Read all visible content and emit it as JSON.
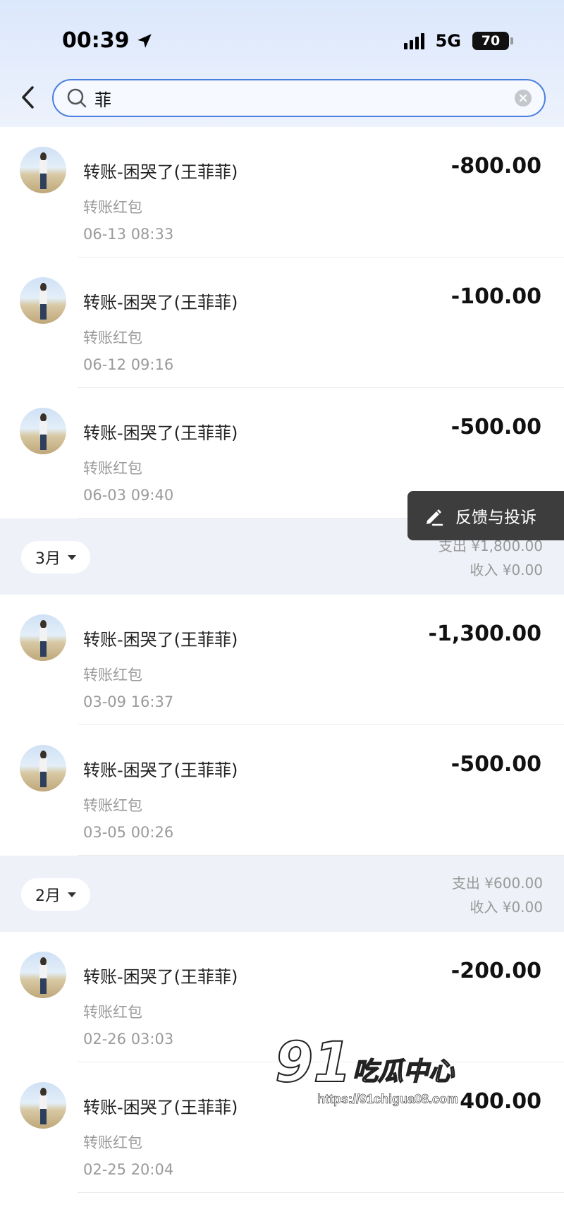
{
  "status_bar": {
    "time": "00:39",
    "network": "5G",
    "battery": "70"
  },
  "search": {
    "value": "菲"
  },
  "sections": [
    {
      "items": [
        {
          "title": "转账-困哭了(王菲菲)",
          "type": "转账红包",
          "time": "06-13 08:33",
          "amount": "-800.00"
        },
        {
          "title": "转账-困哭了(王菲菲)",
          "type": "转账红包",
          "time": "06-12 09:16",
          "amount": "-100.00"
        },
        {
          "title": "转账-困哭了(王菲菲)",
          "type": "转账红包",
          "time": "06-03 09:40",
          "amount": "-500.00"
        }
      ]
    },
    {
      "month": "3月",
      "expense": "支出 ¥1,800.00",
      "income": "收入 ¥0.00",
      "items": [
        {
          "title": "转账-困哭了(王菲菲)",
          "type": "转账红包",
          "time": "03-09 16:37",
          "amount": "-1,300.00"
        },
        {
          "title": "转账-困哭了(王菲菲)",
          "type": "转账红包",
          "time": "03-05 00:26",
          "amount": "-500.00"
        }
      ]
    },
    {
      "month": "2月",
      "expense": "支出 ¥600.00",
      "income": "收入 ¥0.00",
      "items": [
        {
          "title": "转账-困哭了(王菲菲)",
          "type": "转账红包",
          "time": "02-26 03:03",
          "amount": "-200.00"
        },
        {
          "title": "转账-困哭了(王菲菲)",
          "type": "转账红包",
          "time": "02-25 20:04",
          "amount": "400.00"
        }
      ]
    }
  ],
  "feedback_label": "反馈与投诉",
  "watermark": {
    "logo": "91",
    "name": "吃瓜中心",
    "url": "https://91chigua08.com"
  }
}
